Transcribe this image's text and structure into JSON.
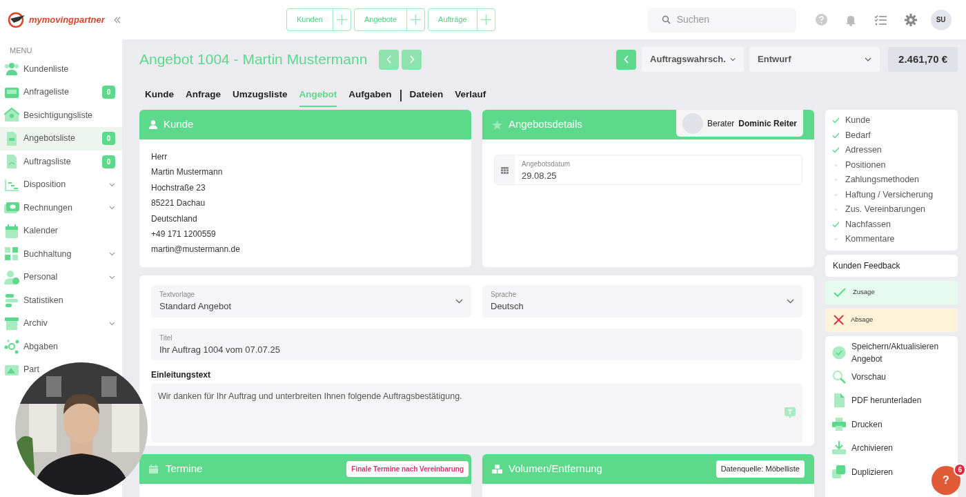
{
  "logo": {
    "text": "mymovingpartner"
  },
  "quick_buttons": [
    {
      "label": "Kunden"
    },
    {
      "label": "Angebote"
    },
    {
      "label": "Aufträge"
    }
  ],
  "search": {
    "placeholder": "Suchen"
  },
  "avatar": {
    "initials": "SU"
  },
  "sidebar": {
    "heading": "MENU",
    "items": [
      {
        "label": "Kundenliste",
        "kind": "link",
        "selected": false
      },
      {
        "label": "Anfrageliste",
        "kind": "link",
        "badge": "0",
        "selected": false
      },
      {
        "label": "Besichtigungsliste",
        "kind": "link",
        "selected": false
      },
      {
        "label": "Angebotsliste",
        "kind": "link",
        "badge": "0",
        "selected": true
      },
      {
        "label": "Auftragsliste",
        "kind": "link",
        "badge": "0",
        "selected": false
      },
      {
        "label": "Disposition",
        "kind": "group",
        "selected": false
      },
      {
        "label": "Rechnungen",
        "kind": "group",
        "selected": false
      },
      {
        "label": "Kalender",
        "kind": "link",
        "selected": false
      },
      {
        "label": "Buchhaltung",
        "kind": "group",
        "selected": false
      },
      {
        "label": "Personal",
        "kind": "group",
        "selected": false
      },
      {
        "label": "Statistiken",
        "kind": "link",
        "selected": false
      },
      {
        "label": "Archiv",
        "kind": "group",
        "selected": false
      },
      {
        "label": "Abgaben",
        "kind": "link",
        "selected": false
      },
      {
        "label": "Part",
        "kind": "link",
        "selected": false
      }
    ]
  },
  "page": {
    "title": "Angebot 1004 - Martin Mustermann",
    "probability": "Auftragswahrsch.",
    "status": "Entwurf",
    "total": "2.461,70 €"
  },
  "tabs": [
    {
      "label": "Kunde",
      "selected": false
    },
    {
      "label": "Anfrage",
      "selected": false
    },
    {
      "label": "Umzugsliste",
      "selected": false
    },
    {
      "label": "Angebot",
      "selected": true
    },
    {
      "label": "Aufgaben",
      "selected": false
    },
    {
      "label": "Dateien",
      "selected": false
    },
    {
      "label": "Verlauf",
      "selected": false
    }
  ],
  "customer_card": {
    "title": "Kunde",
    "lines": [
      "Herr",
      "Martin Mustermann",
      "Hochstraße 23",
      "85221 Dachau",
      "Deutschland",
      "+49 171 1200559",
      "martin@mustermann.de"
    ]
  },
  "details_card": {
    "title": "Angebotsdetails",
    "advisor_label": "Berater",
    "advisor_name": "Dominic Reiter",
    "date_label": "Angebotsdatum",
    "date_value": "29.08.25"
  },
  "text_form": {
    "template_label": "Textvorlage",
    "template_value": "Standard Angebot",
    "language_label": "Sprache",
    "language_value": "Deutsch",
    "title_label": "Titel",
    "title_value": "Ihr Auftrag 1004 vom 07.07.25",
    "intro_label": "Einleitungstext",
    "intro_value": "Wir danken für Ihr Auftrag und unterbreiten Ihnen folgende Auftragsbestätigung."
  },
  "bottom_cards": [
    {
      "title": "Termine",
      "kind": "dates",
      "badge": "Finale Termine nach Vereinbarung"
    },
    {
      "title": "Volumen/Entfernung",
      "kind": "volume",
      "badge": "Datenquelle: Möbelliste"
    }
  ],
  "checklist": [
    {
      "label": "Kunde",
      "checked": true
    },
    {
      "label": "Bedarf",
      "checked": true
    },
    {
      "label": "Adressen",
      "checked": true
    },
    {
      "label": "Positionen",
      "checked": false
    },
    {
      "label": "Zahlungsmethoden",
      "checked": false
    },
    {
      "label": "Haftung / Versicherung",
      "checked": false
    },
    {
      "label": "Zus. Vereinbarungen",
      "checked": false
    },
    {
      "label": "Nachfassen",
      "checked": true
    },
    {
      "label": "Kommentare",
      "checked": false
    }
  ],
  "feedback": {
    "title": "Kunden Feedback",
    "options": [
      {
        "label": "Zusage",
        "kind": "accept"
      },
      {
        "label": "Absage",
        "kind": "reject"
      }
    ]
  },
  "actions": [
    {
      "label": "Speichern/Aktualisieren Angebot",
      "kind": "save"
    },
    {
      "label": "Vorschau",
      "kind": "preview"
    },
    {
      "label": "PDF herunterladen",
      "kind": "pdf"
    },
    {
      "label": "Drucken",
      "kind": "print"
    },
    {
      "label": "Archivieren",
      "kind": "archive"
    },
    {
      "label": "Duplizieren",
      "kind": "duplicate"
    }
  ],
  "help": {
    "label": "?",
    "badge": "6"
  }
}
